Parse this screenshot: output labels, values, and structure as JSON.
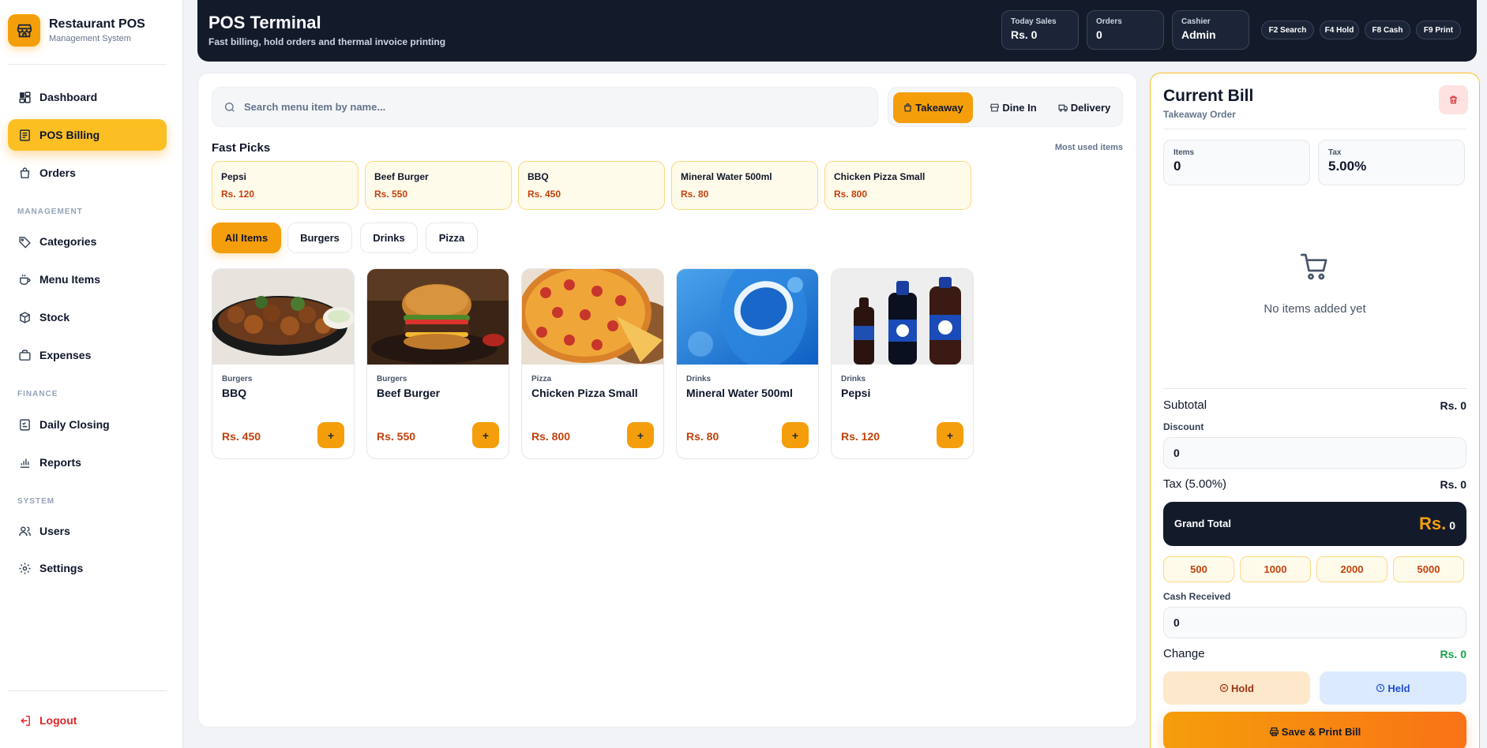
{
  "sidebar": {
    "brand_title": "Restaurant POS",
    "brand_sub": "Management System",
    "items": [
      {
        "label": "Dashboard",
        "icon": "dashboard-icon"
      },
      {
        "label": "POS Billing",
        "icon": "receipt-icon"
      },
      {
        "label": "Orders",
        "icon": "bag-icon"
      },
      {
        "label": "Categories",
        "icon": "tag-icon"
      },
      {
        "label": "Menu Items",
        "icon": "cup-icon"
      },
      {
        "label": "Stock",
        "icon": "box-icon"
      },
      {
        "label": "Expenses",
        "icon": "briefcase-icon"
      },
      {
        "label": "Daily Closing",
        "icon": "checklist-icon"
      },
      {
        "label": "Reports",
        "icon": "bar-chart-icon"
      },
      {
        "label": "Users",
        "icon": "users-icon"
      },
      {
        "label": "Settings",
        "icon": "gear-icon"
      }
    ],
    "sections": [
      "MANAGEMENT",
      "FINANCE",
      "SYSTEM"
    ],
    "logout": "Logout"
  },
  "header": {
    "title": "POS Terminal",
    "subtitle": "Fast billing, hold orders and thermal invoice printing",
    "stats": [
      {
        "label": "Today Sales",
        "value": "Rs. 0"
      },
      {
        "label": "Orders",
        "value": "0"
      },
      {
        "label": "Cashier",
        "value": "Admin"
      }
    ],
    "shortcuts": [
      "F2 Search",
      "F4 Hold",
      "F8 Cash",
      "F9 Print"
    ]
  },
  "main": {
    "search_placeholder": "Search menu item by name...",
    "order_types": [
      "Takeaway",
      "Dine In",
      "Delivery"
    ],
    "fast_picks_title": "Fast Picks",
    "fast_picks_hint": "Most used items",
    "fast_picks": [
      {
        "name": "Pepsi",
        "price": "Rs. 120"
      },
      {
        "name": "Beef Burger",
        "price": "Rs. 550"
      },
      {
        "name": "BBQ",
        "price": "Rs. 450"
      },
      {
        "name": "Mineral Water 500ml",
        "price": "Rs. 80"
      },
      {
        "name": "Chicken Pizza Small",
        "price": "Rs. 800"
      }
    ],
    "categories": [
      "All Items",
      "Burgers",
      "Drinks",
      "Pizza"
    ],
    "products": [
      {
        "category": "Burgers",
        "name": "BBQ",
        "price": "Rs. 450",
        "add": "+"
      },
      {
        "category": "Burgers",
        "name": "Beef Burger",
        "price": "Rs. 550",
        "add": "+"
      },
      {
        "category": "Pizza",
        "name": "Chicken Pizza Small",
        "price": "Rs. 800",
        "add": "+"
      },
      {
        "category": "Drinks",
        "name": "Mineral Water 500ml",
        "price": "Rs. 80",
        "add": "+"
      },
      {
        "category": "Drinks",
        "name": "Pepsi",
        "price": "Rs. 120",
        "add": "+"
      }
    ]
  },
  "bill": {
    "title": "Current Bill",
    "subtitle": "Takeaway Order",
    "items_label": "Items",
    "items_value": "0",
    "tax_label": "Tax",
    "tax_value": "5.00%",
    "empty_text": "No items added yet",
    "subtotal_label": "Subtotal",
    "subtotal_value": "Rs. 0",
    "discount_label": "Discount",
    "discount_value": "0",
    "tax_row_label": "Tax (5.00%)",
    "tax_row_value": "Rs. 0",
    "grand_label": "Grand Total",
    "grand_currency": "Rs.",
    "grand_value": "0",
    "quick_cash": [
      "500",
      "1000",
      "2000",
      "5000"
    ],
    "cash_label": "Cash Received",
    "cash_value": "0",
    "change_label": "Change",
    "change_value": "Rs. 0",
    "hold_label": "Hold",
    "held_label": "Held",
    "save_label": "Save & Print Bill"
  },
  "colors": {
    "accent": "#f59e0b",
    "dark": "#131b2b",
    "price": "#c2410c",
    "success": "#16a34a",
    "danger": "#dc2626"
  }
}
